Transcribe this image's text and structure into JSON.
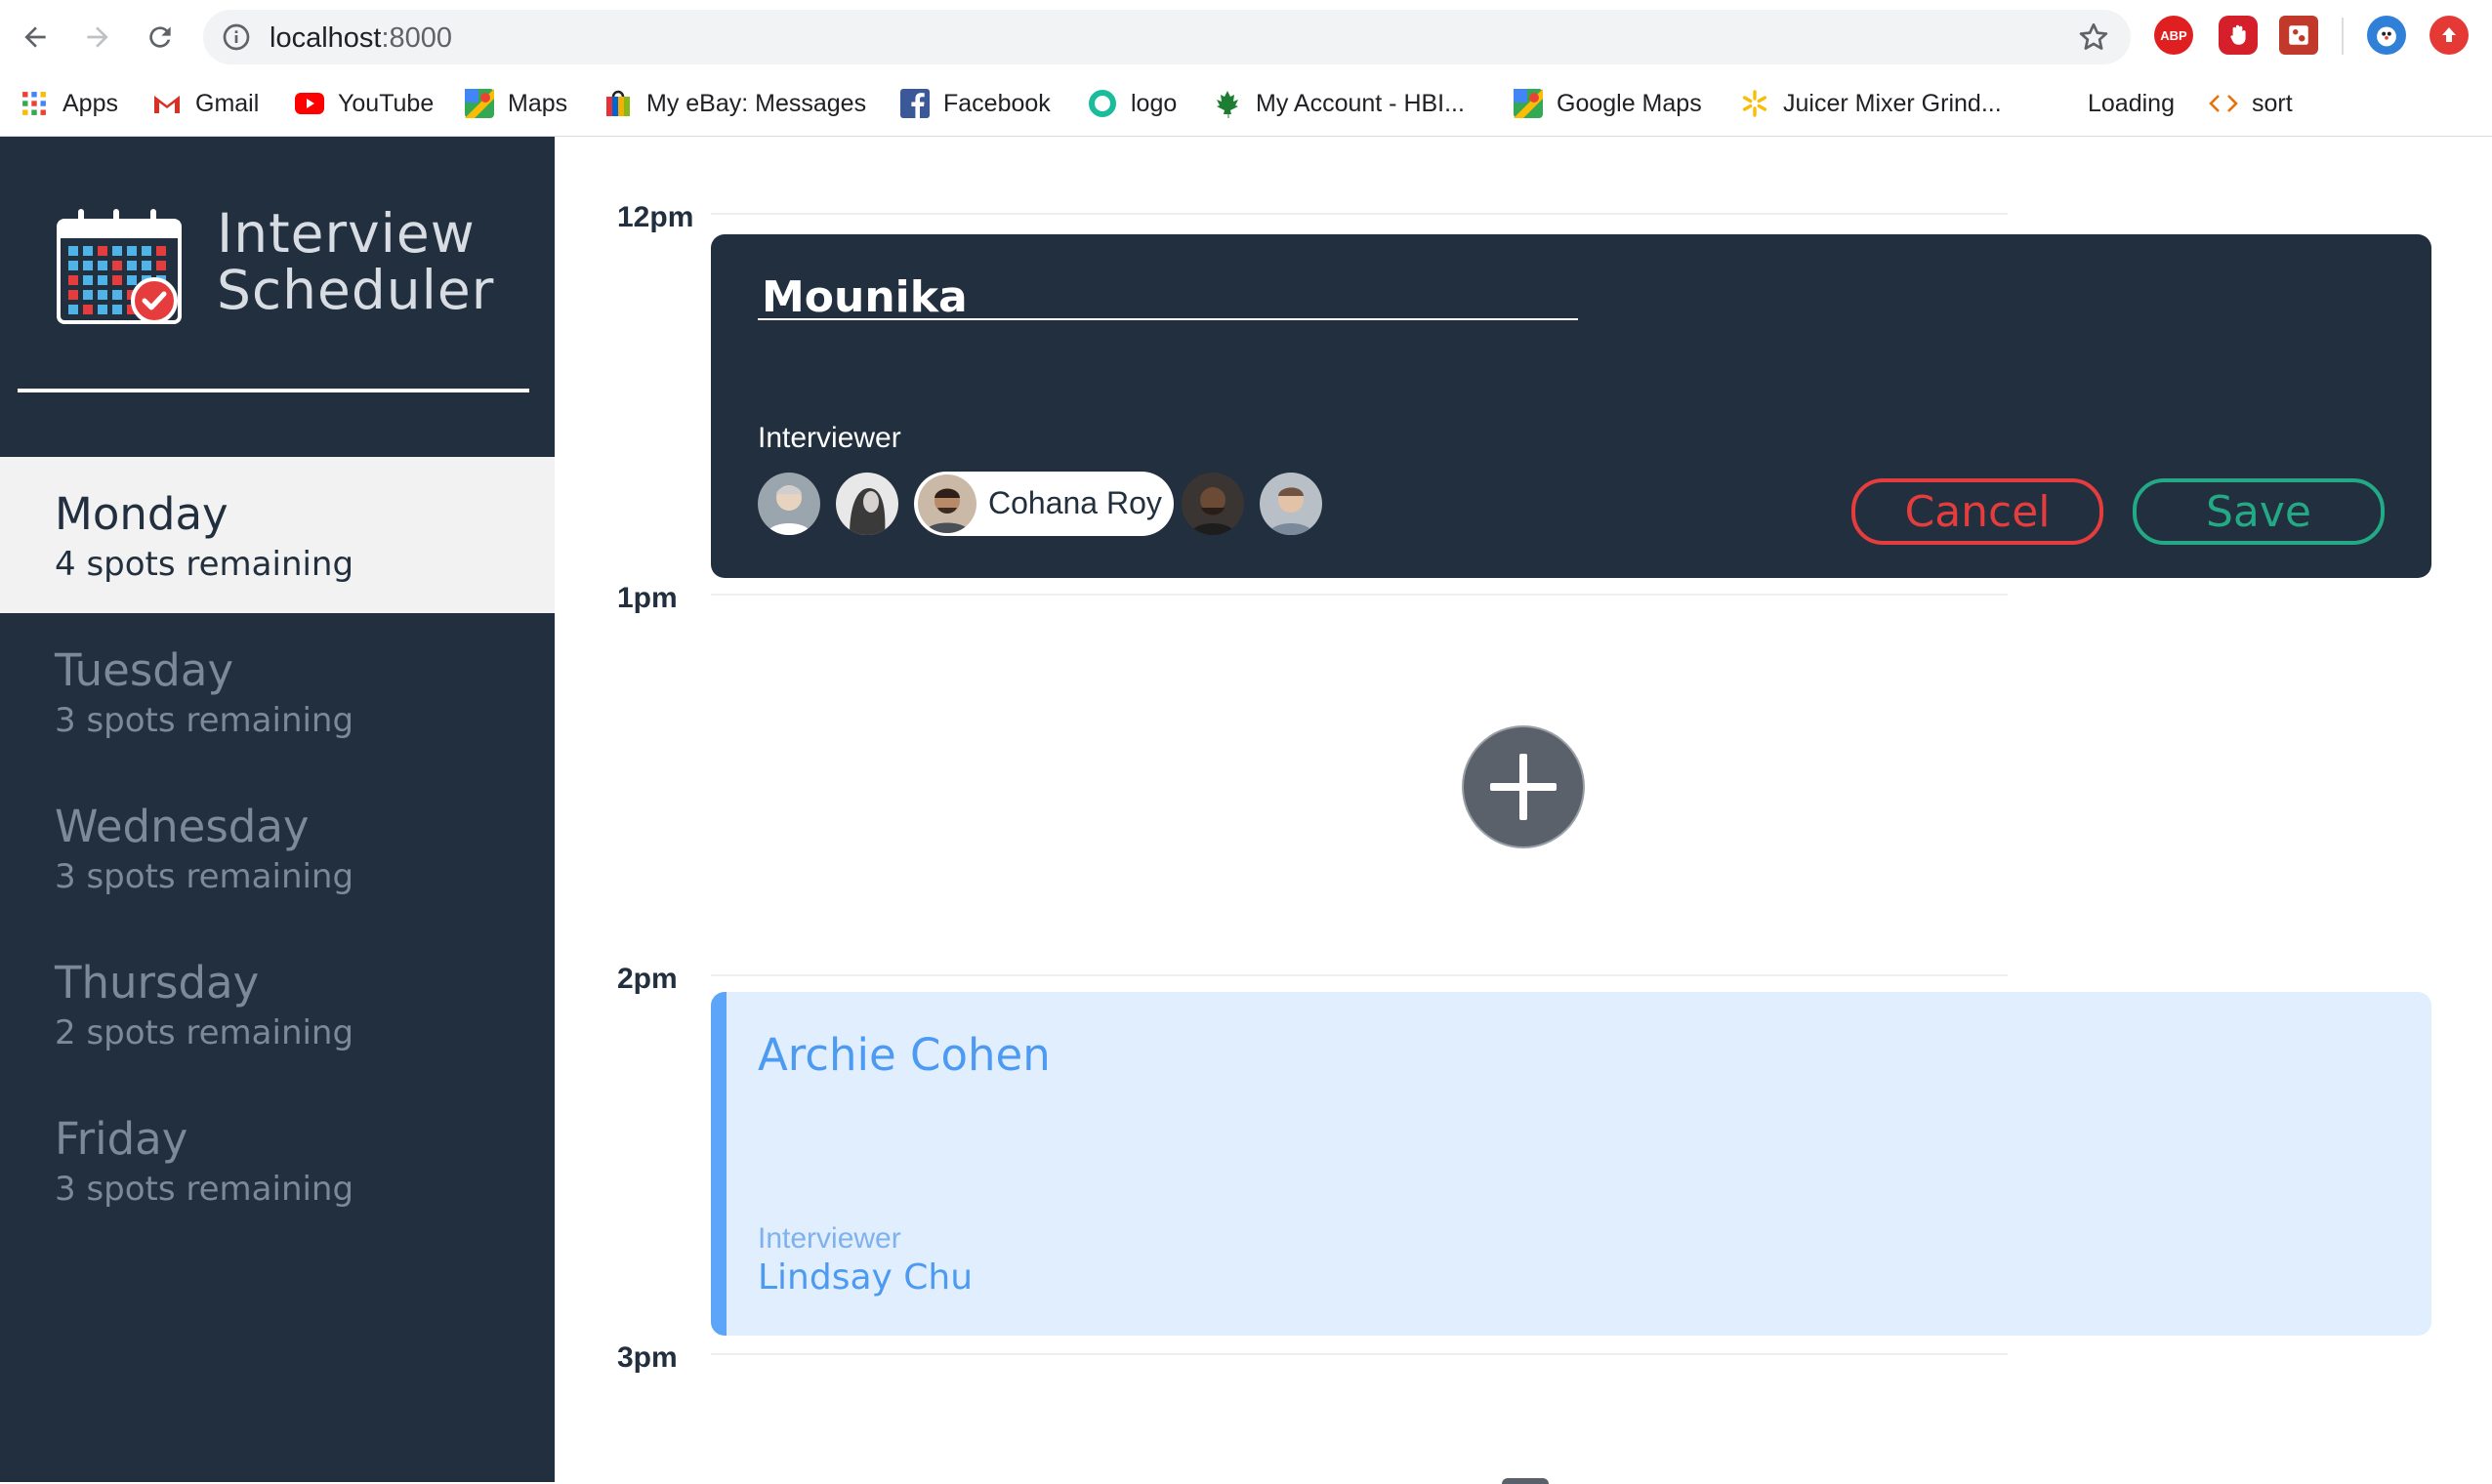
{
  "browser": {
    "url_host": "localhost",
    "url_port": ":8000",
    "bookmarks": [
      {
        "label": "Apps",
        "icon": "apps-grid-icon"
      },
      {
        "label": "Gmail",
        "icon": "gmail-icon"
      },
      {
        "label": "YouTube",
        "icon": "youtube-icon"
      },
      {
        "label": "Maps",
        "icon": "maps-icon"
      },
      {
        "label": "My eBay: Messages",
        "icon": "ebay-icon"
      },
      {
        "label": "Facebook",
        "icon": "facebook-icon"
      },
      {
        "label": "logo",
        "icon": "ring-logo-icon"
      },
      {
        "label": "My Account - HBI...",
        "icon": "maple-leaf-icon"
      },
      {
        "label": "Google Maps",
        "icon": "maps-icon"
      },
      {
        "label": "Juicer Mixer Grind...",
        "icon": "walmart-spark-icon"
      },
      {
        "label": "Loading",
        "icon": ""
      },
      {
        "label": "sort",
        "icon": "code-brackets-icon"
      }
    ],
    "extensions": {
      "abp_label": "ABP"
    }
  },
  "app": {
    "title_line1": "Interview",
    "title_line2": "Scheduler",
    "days": [
      {
        "name": "Monday",
        "spots": "4 spots remaining",
        "selected": true
      },
      {
        "name": "Tuesday",
        "spots": "3 spots remaining",
        "selected": false
      },
      {
        "name": "Wednesday",
        "spots": "3 spots remaining",
        "selected": false
      },
      {
        "name": "Thursday",
        "spots": "2 spots remaining",
        "selected": false
      },
      {
        "name": "Friday",
        "spots": "3 spots remaining",
        "selected": false
      }
    ],
    "hours": [
      "12pm",
      "1pm",
      "2pm",
      "3pm"
    ],
    "form": {
      "student_name": "Mounika",
      "interviewer_label": "Interviewer",
      "selected_interviewer": "Cohana Roy",
      "cancel_label": "Cancel",
      "save_label": "Save"
    },
    "appointment": {
      "student": "Archie Cohen",
      "interviewer_label": "Interviewer",
      "interviewer": "Lindsay Chu"
    },
    "colors": {
      "sidebar_bg": "#222f3e",
      "cancel": "#e53d3d",
      "save": "#23a985",
      "appointment_bg": "#e1eefd",
      "appointment_accent": "#5ca5f8"
    }
  }
}
